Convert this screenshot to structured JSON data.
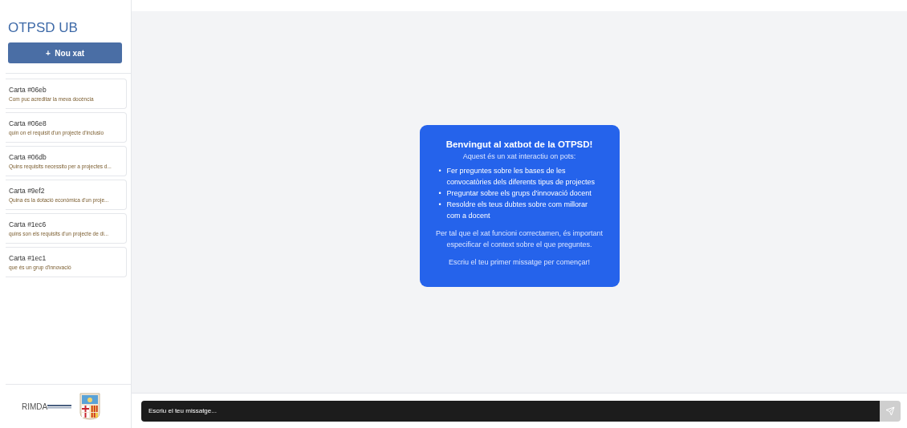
{
  "sidebar": {
    "title": "OTPSD UB",
    "new_chat_button": {
      "icon": "+",
      "label": "Nou xat"
    },
    "chats": [
      {
        "title": "Carta #06eb",
        "preview": "Com puc acreditar la meva docència"
      },
      {
        "title": "Carta #06e8",
        "preview": "quin on el requisit d'un projecte d'inclusio"
      },
      {
        "title": "Carta #06db",
        "preview": "Quins requisits necessito per a projectes d..."
      },
      {
        "title": "Carta #9ef2",
        "preview": "Quina és la dotació econòmica d'un proje..."
      },
      {
        "title": "Carta #1ec6",
        "preview": "quins son els requisits d'un projecte de di..."
      },
      {
        "title": "Carta #1ec1",
        "preview": "que és un grup d'innovació"
      }
    ],
    "footer": {
      "logo_text": "RIMDA"
    }
  },
  "welcome": {
    "title": "Benvingut al xatbot de la OTPSD!",
    "intro": "Aquest és un xat interactiu on pots:",
    "items": [
      {
        "bullet": "•",
        "text": "Fer preguntes sobre les bases de les convocatòries dels diferents tipus de projectes"
      },
      {
        "bullet": "•",
        "text": "Preguntar sobre els grups d'innovació docent"
      },
      {
        "bullet": "•",
        "text": "Resoldre els teus dubtes sobre com millorar com a docent"
      }
    ],
    "note": "Per tal que el xat funcioni correctamen, és important especificar el context sobre el que preguntes.",
    "cta": "Escriu el teu primer missatge per començar!"
  },
  "composer": {
    "placeholder": "Escriu el teu missatge...",
    "send_disabled": true
  }
}
